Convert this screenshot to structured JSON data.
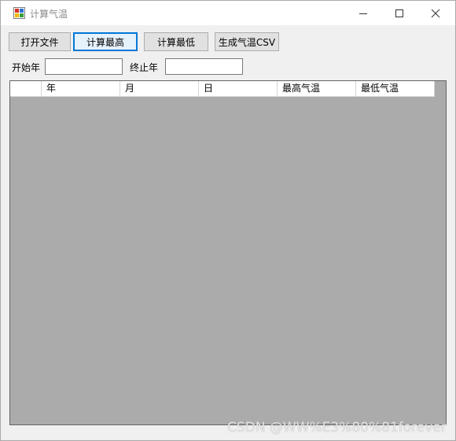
{
  "window": {
    "title": "计算气温",
    "icon": "app-icon",
    "caption_buttons": [
      "minimize-icon",
      "maximize-icon",
      "close-icon"
    ]
  },
  "toolbar": {
    "open_file_label": "打开文件",
    "calc_max_label": "计算最高",
    "calc_min_label": "计算最低",
    "gen_csv_label": "生成气温CSV"
  },
  "filters": {
    "start_year_label": "开始年",
    "start_year_value": "",
    "end_year_label": "终止年",
    "end_year_value": ""
  },
  "grid": {
    "columns": [
      "年",
      "月",
      "日",
      "最高气温",
      "最低气温"
    ],
    "rows": []
  },
  "watermark": "CSDN @WW%E3%80%81forever",
  "colors": {
    "focus_border": "#0078d7",
    "grid_background": "#ababab",
    "window_background": "#f0f0f0"
  }
}
